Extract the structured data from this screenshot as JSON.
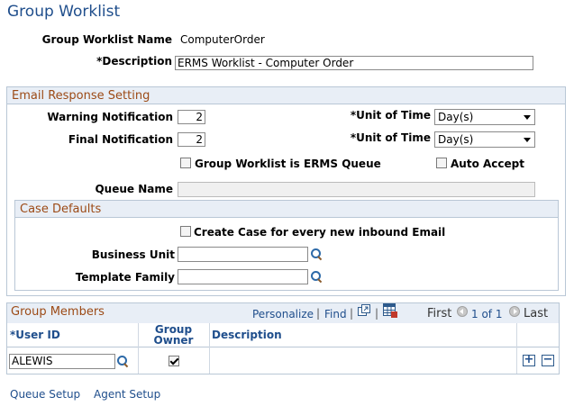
{
  "page": {
    "title": "Group Worklist"
  },
  "header": {
    "worklist_name_label": "Group Worklist Name",
    "worklist_name_value": "ComputerOrder",
    "description_label": "*Description",
    "description_value": "ERMS Worklist - Computer Order"
  },
  "email_response": {
    "section_title": "Email Response Setting",
    "warning_label": "Warning Notification",
    "warning_value": "2",
    "final_label": "Final Notification",
    "final_value": "2",
    "unit_label": "*Unit of Time",
    "warning_unit": "Day(s)",
    "final_unit": "Day(s)",
    "erms_queue_label": "Group Worklist is ERMS Queue",
    "erms_queue_checked": false,
    "auto_accept_label": "Auto Accept",
    "auto_accept_checked": false,
    "queue_name_label": "Queue Name",
    "queue_name_value": ""
  },
  "case_defaults": {
    "section_title": "Case Defaults",
    "create_case_label": "Create Case for every new inbound Email",
    "create_case_checked": false,
    "business_unit_label": "Business Unit",
    "business_unit_value": "",
    "template_family_label": "Template Family",
    "template_family_value": ""
  },
  "group_members": {
    "title": "Group Members",
    "personalize_label": "Personalize",
    "separator": "|",
    "find_label": "Find",
    "first_label": "First",
    "page_info": "1 of 1",
    "last_label": "Last",
    "columns": {
      "user_id": "*User ID",
      "group_owner_line1": "Group",
      "group_owner_line2": "Owner",
      "description": "Description"
    },
    "rows": [
      {
        "user_id": "ALEWIS",
        "group_owner": true,
        "description": ""
      }
    ]
  },
  "footer": {
    "queue_setup_label": "Queue Setup",
    "agent_setup_label": "Agent Setup"
  },
  "icons": {
    "lookup": "magnifier-icon",
    "view_all": "view-all-icon",
    "download": "download-to-excel-icon",
    "add_row": "plus-icon",
    "delete_row": "minus-icon"
  },
  "colors": {
    "title": "#1f4e8c",
    "section_title": "#9c4a16",
    "section_bg": "#e8eef6",
    "border": "#b9c7d6"
  }
}
